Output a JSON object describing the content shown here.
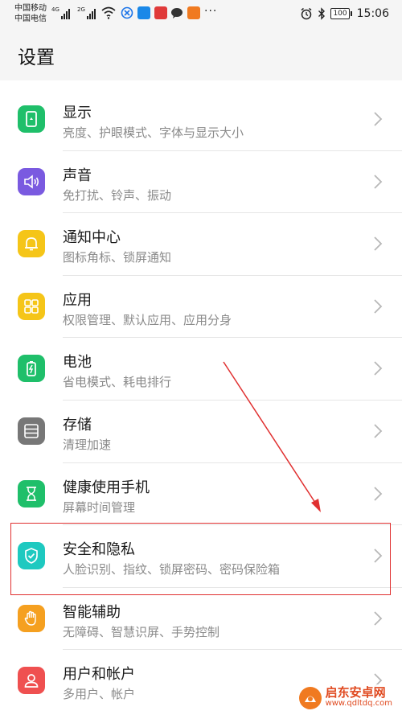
{
  "status_bar": {
    "carrier_1": "中国移动",
    "carrier_2": "中国电信",
    "net_1": "4G",
    "net_2": "2G",
    "battery": "100",
    "time": "15:06",
    "more": "···"
  },
  "header": {
    "title": "设置"
  },
  "items": [
    {
      "title": "显示",
      "subtitle": "亮度、护眼模式、字体与显示大小",
      "icon": "display-icon",
      "color": "#1fbf6a"
    },
    {
      "title": "声音",
      "subtitle": "免打扰、铃声、振动",
      "icon": "sound-icon",
      "color": "#7a5ae0"
    },
    {
      "title": "通知中心",
      "subtitle": "图标角标、锁屏通知",
      "icon": "bell-icon",
      "color": "#f5c518"
    },
    {
      "title": "应用",
      "subtitle": "权限管理、默认应用、应用分身",
      "icon": "apps-icon",
      "color": "#f5c518"
    },
    {
      "title": "电池",
      "subtitle": "省电模式、耗电排行",
      "icon": "battery-icon",
      "color": "#1fbf6a"
    },
    {
      "title": "存储",
      "subtitle": "清理加速",
      "icon": "storage-icon",
      "color": "#777777"
    },
    {
      "title": "健康使用手机",
      "subtitle": "屏幕时间管理",
      "icon": "hourglass-icon",
      "color": "#1fbf6a"
    },
    {
      "title": "安全和隐私",
      "subtitle": "人脸识别、指纹、锁屏密码、密码保险箱",
      "icon": "shield-icon",
      "color": "#1ec9c0"
    },
    {
      "title": "智能辅助",
      "subtitle": "无障碍、智慧识屏、手势控制",
      "icon": "hand-icon",
      "color": "#f5a020"
    },
    {
      "title": "用户和帐户",
      "subtitle": "多用户、帐户",
      "icon": "user-icon",
      "color": "#ef5050"
    }
  ],
  "watermark": {
    "title": "启东安卓网",
    "url": "www.qdltdq.com"
  },
  "colors": {
    "highlight": "#e03030",
    "chevron": "#b8b8b8"
  }
}
